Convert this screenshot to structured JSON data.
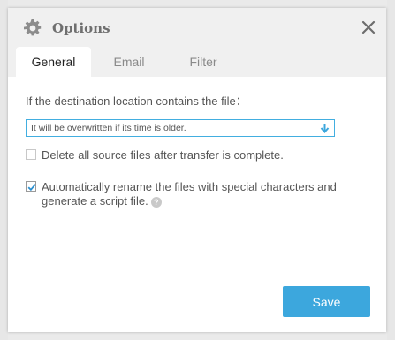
{
  "dialog": {
    "title": "Options",
    "title_icon": "gear-icon",
    "close_icon": "close-icon"
  },
  "tabs": [
    {
      "label": "General",
      "active": true
    },
    {
      "label": "Email",
      "active": false
    },
    {
      "label": "Filter",
      "active": false
    }
  ],
  "general": {
    "destination_label": "If the destination location contains the file：",
    "destination_select": {
      "selected": "It will be overwritten if its time is older.",
      "arrow_icon": "arrow-down-icon"
    },
    "delete_source": {
      "label": "Delete all source files after transfer is complete.",
      "checked": false
    },
    "auto_rename": {
      "label_line1": "Automatically rename the files with special characters and",
      "label_line2": "generate a script file.",
      "checked": true,
      "help_icon": "help-icon",
      "help_glyph": "?"
    }
  },
  "footer": {
    "save_label": "Save"
  },
  "colors": {
    "accent": "#3ca7dd",
    "titlebar": "#f0f0f0",
    "text": "#555555"
  }
}
